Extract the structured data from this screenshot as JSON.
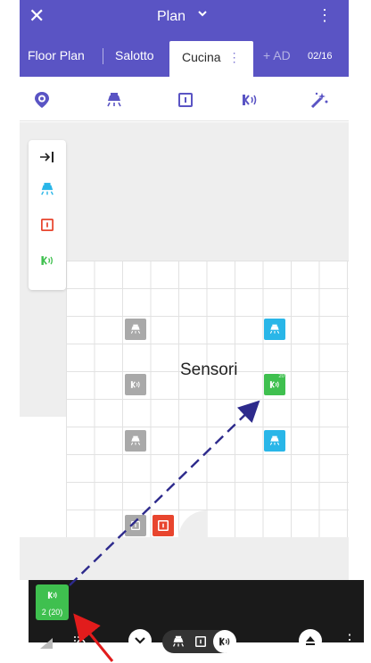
{
  "header": {
    "title": "Plan",
    "close_glyph": "✕",
    "chevron_glyph": "⌄",
    "menu_glyph": "⋮"
  },
  "tabs": {
    "items": [
      {
        "label": "Floor Plan"
      },
      {
        "label": "Salotto"
      },
      {
        "label": "Cucina"
      }
    ],
    "active_menu_glyph": "⋮",
    "add_label": "+ AD",
    "page_indicator": "02/16"
  },
  "toolbar": {
    "icons": [
      "location-pin-icon",
      "ceiling-lamp-icon",
      "socket-icon",
      "sensor-icon",
      "magic-wand-icon"
    ]
  },
  "palette": {
    "collapse_glyph": "→|",
    "items": [
      "ceiling-lamp-icon",
      "socket-icon",
      "sensor-icon"
    ]
  },
  "floorplan": {
    "annotation": "Sensori",
    "devices": [
      {
        "type": "lamp",
        "state": "inactive"
      },
      {
        "type": "sensor",
        "state": "inactive"
      },
      {
        "type": "lamp",
        "state": "inactive"
      },
      {
        "type": "socket",
        "state": "inactive"
      },
      {
        "type": "lamp",
        "state": "active"
      },
      {
        "type": "sensor",
        "state": "active",
        "sub": "20"
      },
      {
        "type": "lamp",
        "state": "active"
      },
      {
        "type": "socket",
        "state": "active"
      }
    ]
  },
  "dock": {
    "device_label": "2 (20)"
  },
  "colors": {
    "primary": "#5a54c4",
    "lamp_active": "#29b6e8",
    "sensor_active": "#3fc04f",
    "socket_active": "#e8452e",
    "inactive": "#a9a9a9",
    "arrow_blue": "#2d2a8c",
    "arrow_red": "#e11c1c"
  }
}
